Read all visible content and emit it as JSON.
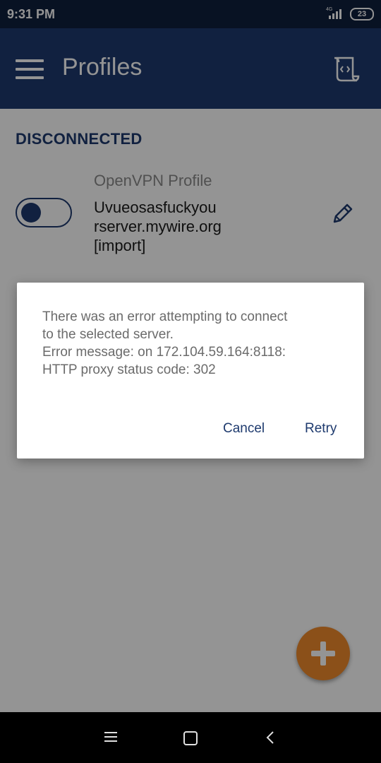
{
  "status_bar": {
    "time": "9:31 PM",
    "network": "4G",
    "battery": "23"
  },
  "app_bar": {
    "title": "Profiles",
    "menu_icon": "hamburger-menu-icon",
    "action_icon": "log-scroll-icon"
  },
  "content": {
    "section_header": "DISCONNECTED",
    "profile": {
      "type": "OpenVPN Profile",
      "name_lines": [
        "Uvueosasfuckyou",
        "rserver.mywire.org",
        "[import]"
      ],
      "enabled": false
    },
    "fab_icon": "plus-icon"
  },
  "dialog": {
    "message_lines": [
      "There was an error attempting to connect",
      "to the selected server.",
      "Error message: on 172.104.59.164:8118:",
      "HTTP proxy status code: 302"
    ],
    "cancel_label": "Cancel",
    "retry_label": "Retry"
  },
  "colors": {
    "primary": "#1e3a6e",
    "status_bar": "#0f1f3d",
    "accent": "#ef8b2c"
  }
}
